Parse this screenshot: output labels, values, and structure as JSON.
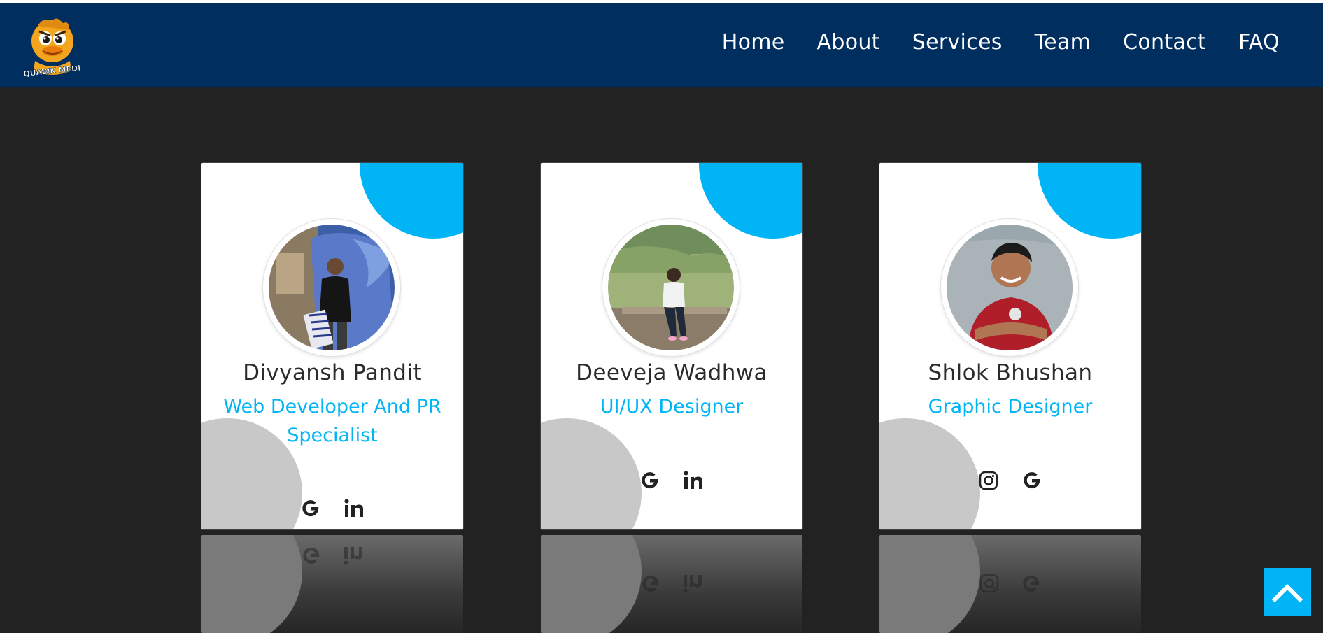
{
  "brand": {
    "logo_alt": "Squawk Media",
    "logo_text": "SQUAWK MEDIA"
  },
  "nav": {
    "items": [
      {
        "label": "Home"
      },
      {
        "label": "About"
      },
      {
        "label": "Services"
      },
      {
        "label": "Team"
      },
      {
        "label": "Contact"
      },
      {
        "label": "FAQ"
      }
    ]
  },
  "team": {
    "members": [
      {
        "name": "Divyansh Pandit",
        "role": "Web Developer And PR Specialist",
        "socials": [
          "google-icon",
          "linkedin-icon"
        ]
      },
      {
        "name": "Deeveja Wadhwa",
        "role": "UI/UX Designer",
        "socials": [
          "google-icon",
          "linkedin-icon"
        ]
      },
      {
        "name": "Shlok Bhushan",
        "role": "Graphic Designer",
        "socials": [
          "instagram-icon",
          "google-icon"
        ]
      }
    ]
  },
  "colors": {
    "navbar": "#002e5f",
    "accent": "#00b4f5",
    "page_bg": "#222222",
    "blob_gray": "#c8c8c8",
    "text_dark": "#2b2b2b"
  },
  "scroll_top": {
    "icon": "chevron-up-icon"
  }
}
